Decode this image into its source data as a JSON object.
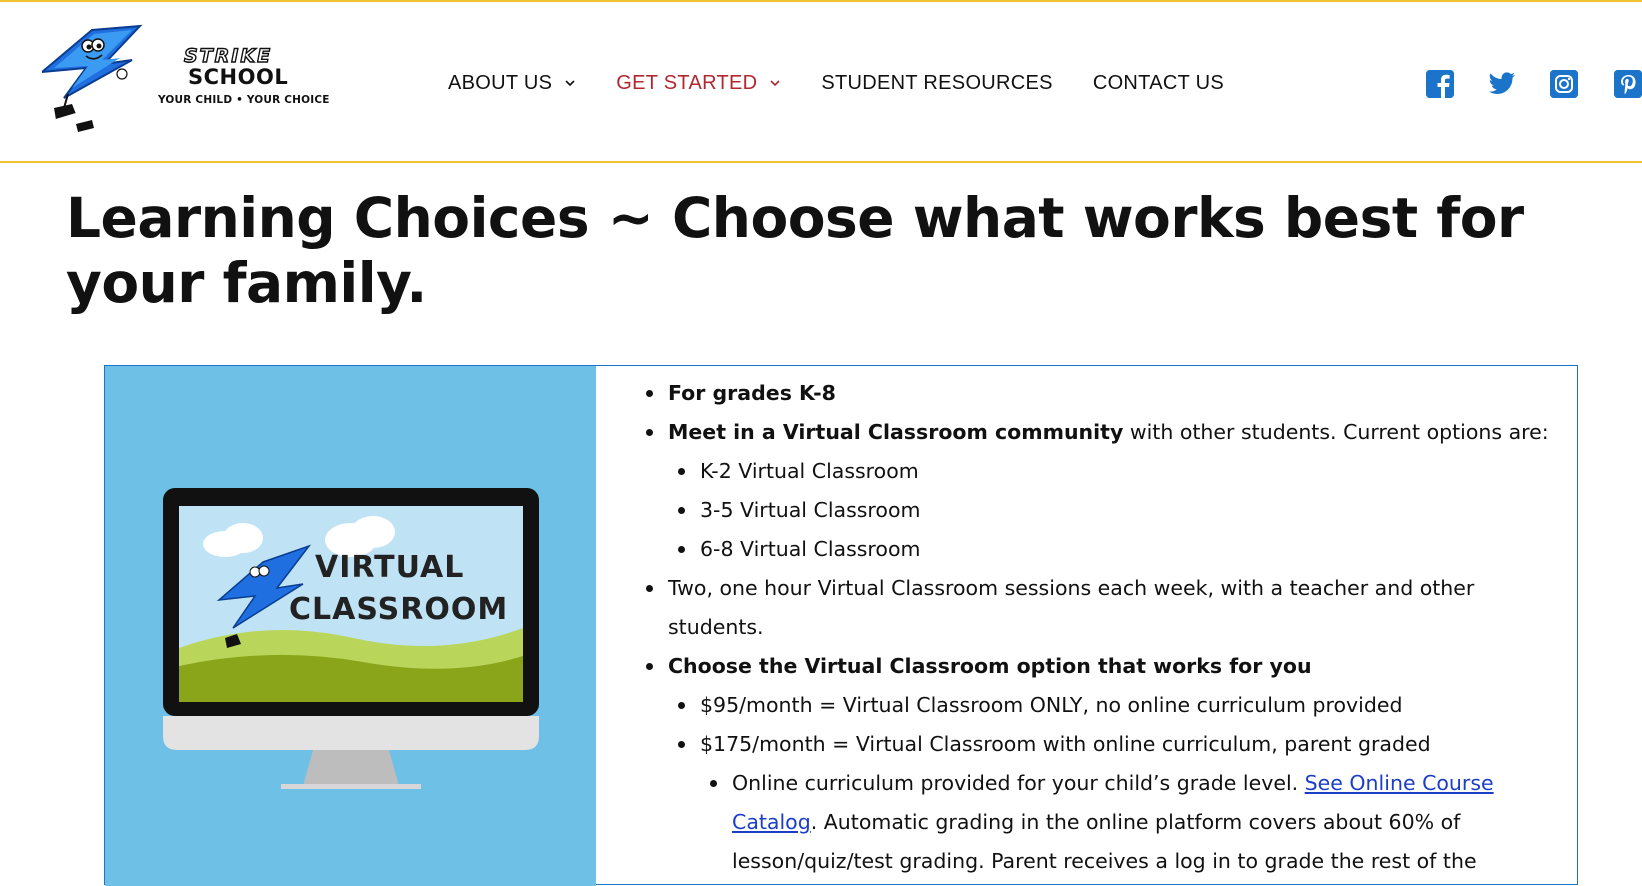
{
  "brand": {
    "logo_word1": "STRIKE",
    "logo_word2": "SCHOOL",
    "tagline": "YOUR CHILD • YOUR CHOICE",
    "accent_color": "#f2c230",
    "active_color": "#b3262d",
    "icon_color": "#1b74c9"
  },
  "nav": {
    "items": [
      {
        "label": "ABOUT US",
        "has_dropdown": true,
        "active": false
      },
      {
        "label": "GET STARTED",
        "has_dropdown": true,
        "active": true
      },
      {
        "label": "STUDENT RESOURCES",
        "has_dropdown": false,
        "active": false
      },
      {
        "label": "CONTACT US",
        "has_dropdown": false,
        "active": false
      }
    ],
    "social": [
      "facebook-icon",
      "twitter-icon",
      "instagram-icon",
      "pinterest-icon"
    ]
  },
  "page": {
    "title": "Learning Choices ~ Choose what works best for your family."
  },
  "card": {
    "image_title_line1": "VIRTUAL",
    "image_title_line2": "CLASSROOM",
    "grades": "For grades K-8",
    "meet_bold": "Meet in a Virtual Classroom community",
    "meet_rest": " with other students. Current options are:",
    "classrooms": [
      "K-2 Virtual Classroom",
      "3-5 Virtual Classroom",
      "6-8 Virtual Classroom"
    ],
    "sessions": "Two, one hour Virtual Classroom sessions each week, with a teacher and other students.",
    "choose_option": "Choose the Virtual Classroom option that works for you",
    "options": [
      "$95/month = Virtual Classroom ONLY, no online curriculum provided",
      "$175/month = Virtual Classroom with online curriculum, parent graded"
    ],
    "curriculum_text": "Online curriculum provided for your child’s grade level. ",
    "catalog_link": "See Online Course Catalog",
    "curriculum_rest": ". Automatic grading in the online platform covers about 60% of lesson/quiz/test grading. Parent receives a log in to grade the rest of the"
  }
}
